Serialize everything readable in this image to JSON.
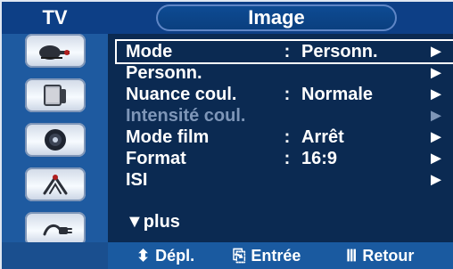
{
  "tv_tab": {
    "label": "TV"
  },
  "menu": {
    "title": "Image",
    "items": [
      {
        "label": "Mode",
        "sep": ":",
        "value": "Personn.",
        "arrow": "►"
      },
      {
        "label": "Personn.",
        "sep": "",
        "value": "",
        "arrow": "►"
      },
      {
        "label": "Nuance coul.",
        "sep": ":",
        "value": "Normale",
        "arrow": "►"
      },
      {
        "label": "Intensité coul.",
        "sep": "",
        "value": "",
        "arrow": "►"
      },
      {
        "label": "Mode film",
        "sep": ":",
        "value": "Arrêt",
        "arrow": "►"
      },
      {
        "label": "Format",
        "sep": ":",
        "value": "16:9",
        "arrow": "►"
      },
      {
        "label": "ISI",
        "sep": "",
        "value": "",
        "arrow": "►"
      }
    ],
    "more_label": "▼plus"
  },
  "footer": {
    "move_icon": "⬍",
    "move_label": "Dépl.",
    "enter_icon": "⎘",
    "enter_label": "Entrée",
    "return_icon": "Ⅲ",
    "return_label": "Retour"
  },
  "colors": {
    "sidebar": "#1e5aa0",
    "header": "#0d3f86",
    "menu_bg": "#0b2a52",
    "disabled_text": "#7e96b8"
  },
  "sidebar_icons": [
    "satellite-dish-icon",
    "speaker-icon",
    "subwoofer-icon",
    "antenna-icon",
    "plug-icon"
  ]
}
